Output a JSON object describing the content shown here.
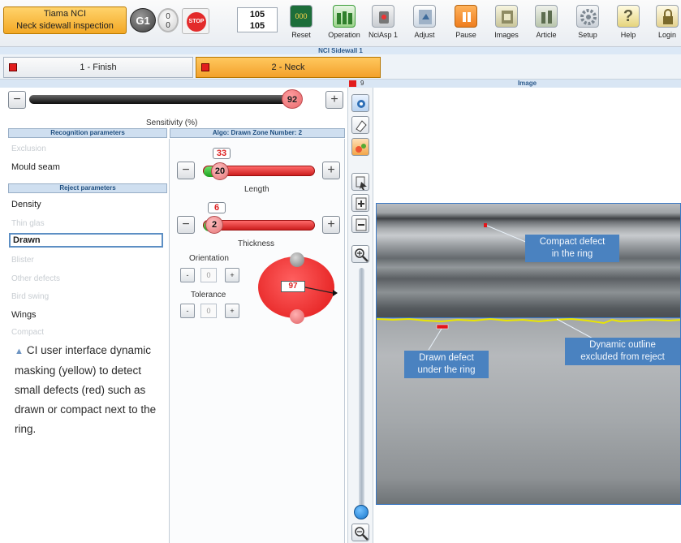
{
  "app": {
    "name": "Tiama NCI",
    "subtitle": "Neck sidewall inspection",
    "group_badge": "G1",
    "counter_top": "0",
    "counter_bottom": "0",
    "stop_label": "STOP",
    "count_top": "105",
    "count_bottom": "105"
  },
  "toolbar": {
    "buttons": [
      {
        "label": "Reset",
        "icon": "counter-reset-icon",
        "color": "#1d6e3a"
      },
      {
        "label": "Operation",
        "icon": "bottles-icon",
        "color": "#3a9c38"
      },
      {
        "label": "NciAsp 1",
        "icon": "camera-icon",
        "color": "#8f9aa4"
      },
      {
        "label": "Adjust",
        "icon": "adjust-icon",
        "color": "#9fb2c7"
      },
      {
        "label": "Pause",
        "icon": "pause-icon",
        "color": "#ee8c2a"
      },
      {
        "label": "Images",
        "icon": "images-icon",
        "color": "#b9b9a2"
      },
      {
        "label": "Article",
        "icon": "article-icon",
        "color": "#8ea080"
      },
      {
        "label": "Setup",
        "icon": "gear-icon",
        "color": "#b8bfc7"
      },
      {
        "label": "Help",
        "icon": "help-icon",
        "color": "#d8c65a"
      },
      {
        "label": "Login",
        "icon": "lock-icon",
        "color": "#c9b56a"
      }
    ]
  },
  "section_title": "NCI Sidewall 1",
  "zones": {
    "tab1": "1 - Finish",
    "tab2": "2 - Neck"
  },
  "sensitivity": {
    "value": "92",
    "label": "Sensitivity (%)",
    "minus": "−",
    "plus": "+"
  },
  "recognition": {
    "header": "Recognition parameters",
    "items": [
      {
        "label": "Exclusion",
        "active": false
      },
      {
        "label": "Mould seam",
        "active": true
      }
    ]
  },
  "reject": {
    "header": "Reject parameters",
    "items": [
      {
        "label": "Density",
        "active": true
      },
      {
        "label": "Thin glas",
        "active": false
      },
      {
        "label": "Drawn",
        "active": true,
        "selected": true
      },
      {
        "label": "Blister",
        "active": false
      },
      {
        "label": "Other defects",
        "active": false
      },
      {
        "label": "Bird swing",
        "active": false
      },
      {
        "label": "Wings",
        "active": true
      },
      {
        "label": "Compact",
        "active": false
      }
    ]
  },
  "algo": {
    "header": "Algo: Drawn Zone Number: 2",
    "length": {
      "label": "Length",
      "value": "20",
      "bubble": "33"
    },
    "thickness": {
      "label": "Thickness",
      "value": "2",
      "bubble": "6"
    },
    "orientation": {
      "label": "Orientation",
      "value": "0",
      "minus": "-",
      "plus": "+"
    },
    "tolerance": {
      "label": "Tolerance",
      "value": "0",
      "minus": "-",
      "plus": "+"
    },
    "circle_value": "97"
  },
  "caption": "CI user interface dynamic masking (yellow) to detect small defects (red) such as drawn or compact next to the ring.",
  "image_panel": {
    "header": "Image",
    "zone_number": "9",
    "callouts": {
      "compact": "Compact defect\nin the ring",
      "drawn": "Drawn defect\nunder the ring",
      "outline": "Dynamic outline\nexcluded from reject"
    },
    "mask_color": "#e9e500",
    "defect_color": "#e3161b"
  }
}
